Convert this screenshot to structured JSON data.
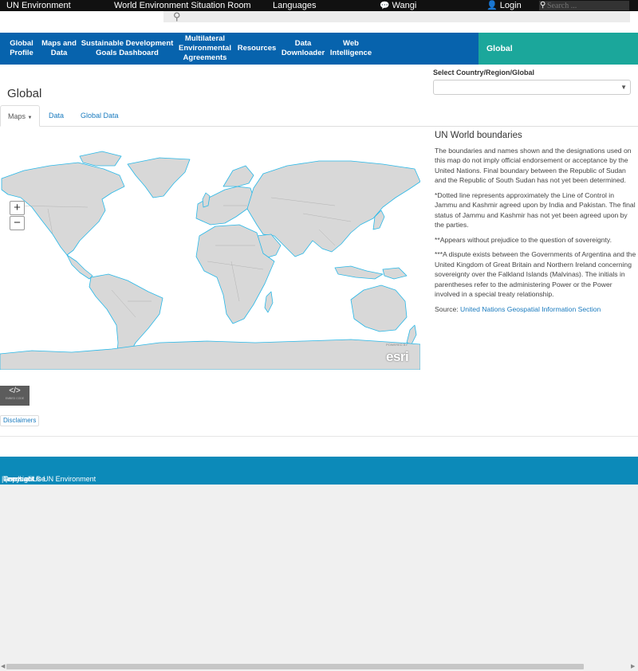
{
  "topbar": {
    "brand": "UN Environment",
    "room": "World Environment Situation Room",
    "languages": "Languages",
    "wangi": "Wangi",
    "login": "Login",
    "search_placeholder": "Search ..."
  },
  "nav": {
    "items": [
      "Global Profile",
      "Maps and Data",
      "Sustainable Development Goals Dashboard",
      "Multilateral Environmental Agreements",
      "Resources",
      "Data Downloader",
      "Web Intelligence"
    ],
    "active_section": "Global"
  },
  "page": {
    "title": "Global",
    "select_label": "Select Country/Region/Global",
    "select_value": ""
  },
  "tabs": {
    "maps": "Maps",
    "data": "Data",
    "global_data": "Global Data"
  },
  "map": {
    "zoom_in": "+",
    "zoom_out": "−",
    "attribution_small": "POWERED BY",
    "attribution": "esri"
  },
  "info": {
    "heading": "UN World boundaries",
    "p1": "The boundaries and names shown and the designations used on this map do not imply official endorsement or acceptance by the United Nations. Final boundary between the Republic of Sudan and the Republic of South Sudan has not yet been determined.",
    "p2": "*Dotted line represents approximately the Line of Control in Jammu and Kashmir agreed upon by India and Pakistan. The final status of Jammu and Kashmir has not yet been agreed upon by the parties.",
    "p3": "**Appears without prejudice to the question of sovereignty.",
    "p4": "***A dispute exists between the Governments of Argentina and the United Kingdom of Great Britain and Northern Ireland concerning sovereignty over the Falkland Islands (Malvinas). The initials in parentheses refer to the administering Power or the Power involved in a special treaty relationship.",
    "source_label": "Source:",
    "source_link": "United Nations Geospatial Information Section"
  },
  "embed": {
    "code_symbol": "</>",
    "caption": "EMBED CODE"
  },
  "disclaimers": "Disclaimers",
  "footer": {
    "copyright": "Copyright © UN Environment",
    "terms": "Terms of Use",
    "feedback": "Feedback"
  },
  "colors": {
    "nav_blue": "#0763ad",
    "global_teal": "#1ba79b",
    "footer_blue": "#0c8ab9",
    "land": "#d8d8d8",
    "coast": "#28b8e8"
  }
}
